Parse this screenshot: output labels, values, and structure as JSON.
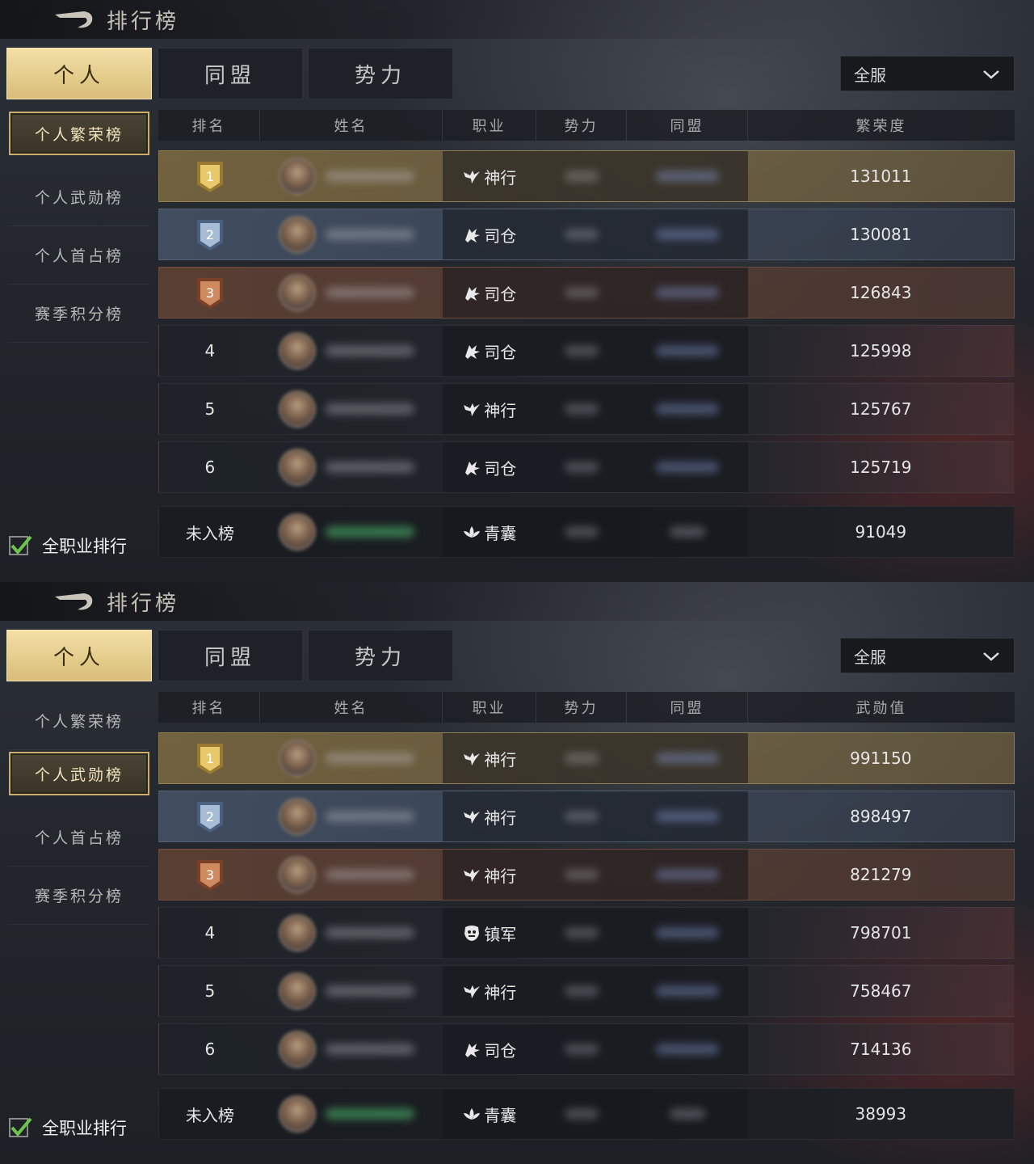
{
  "panels": [
    {
      "title": "排行榜",
      "tabs": [
        "个人",
        "同盟",
        "势力"
      ],
      "active_tab": 0,
      "server": "全服",
      "side_items": [
        "个人繁荣榜",
        "个人武勋榜",
        "个人首占榜",
        "赛季积分榜"
      ],
      "active_side": 0,
      "headers": {
        "rank": "排名",
        "name": "姓名",
        "job": "职业",
        "power": "势力",
        "alliance": "同盟",
        "score": "繁荣度"
      },
      "rows": [
        {
          "rank": "1",
          "medal": "gold",
          "job": "神行",
          "job_icon": "bird-icon",
          "score": "131011"
        },
        {
          "rank": "2",
          "medal": "silver",
          "job": "司仓",
          "job_icon": "beast-icon",
          "score": "130081"
        },
        {
          "rank": "3",
          "medal": "bronze",
          "job": "司仓",
          "job_icon": "beast-icon",
          "score": "126843"
        },
        {
          "rank": "4",
          "medal": "",
          "job": "司仓",
          "job_icon": "beast-icon",
          "score": "125998"
        },
        {
          "rank": "5",
          "medal": "",
          "job": "神行",
          "job_icon": "bird-icon",
          "score": "125767"
        },
        {
          "rank": "6",
          "medal": "",
          "job": "司仓",
          "job_icon": "beast-icon",
          "score": "125719"
        }
      ],
      "self_row": {
        "rank": "未入榜",
        "job": "青囊",
        "job_icon": "lotus-icon",
        "score": "91049"
      },
      "all_job_label": "全职业排行"
    },
    {
      "title": "排行榜",
      "tabs": [
        "个人",
        "同盟",
        "势力"
      ],
      "active_tab": 0,
      "server": "全服",
      "side_items": [
        "个人繁荣榜",
        "个人武勋榜",
        "个人首占榜",
        "赛季积分榜"
      ],
      "active_side": 1,
      "headers": {
        "rank": "排名",
        "name": "姓名",
        "job": "职业",
        "power": "势力",
        "alliance": "同盟",
        "score": "武勋值"
      },
      "rows": [
        {
          "rank": "1",
          "medal": "gold",
          "job": "神行",
          "job_icon": "bird-icon",
          "score": "991150"
        },
        {
          "rank": "2",
          "medal": "silver",
          "job": "神行",
          "job_icon": "bird-icon",
          "score": "898497"
        },
        {
          "rank": "3",
          "medal": "bronze",
          "job": "神行",
          "job_icon": "bird-icon",
          "score": "821279"
        },
        {
          "rank": "4",
          "medal": "",
          "job": "镇军",
          "job_icon": "mask-icon",
          "score": "798701"
        },
        {
          "rank": "5",
          "medal": "",
          "job": "神行",
          "job_icon": "bird-icon",
          "score": "758467"
        },
        {
          "rank": "6",
          "medal": "",
          "job": "司仓",
          "job_icon": "beast-icon",
          "score": "714136"
        }
      ],
      "self_row": {
        "rank": "未入榜",
        "job": "青囊",
        "job_icon": "lotus-icon",
        "score": "38993"
      },
      "all_job_label": "全职业排行"
    }
  ],
  "colors": {
    "gold": "#d8bd78",
    "silver": "#7f97b8",
    "bronze": "#b0704e",
    "check": "#6fc24a"
  }
}
